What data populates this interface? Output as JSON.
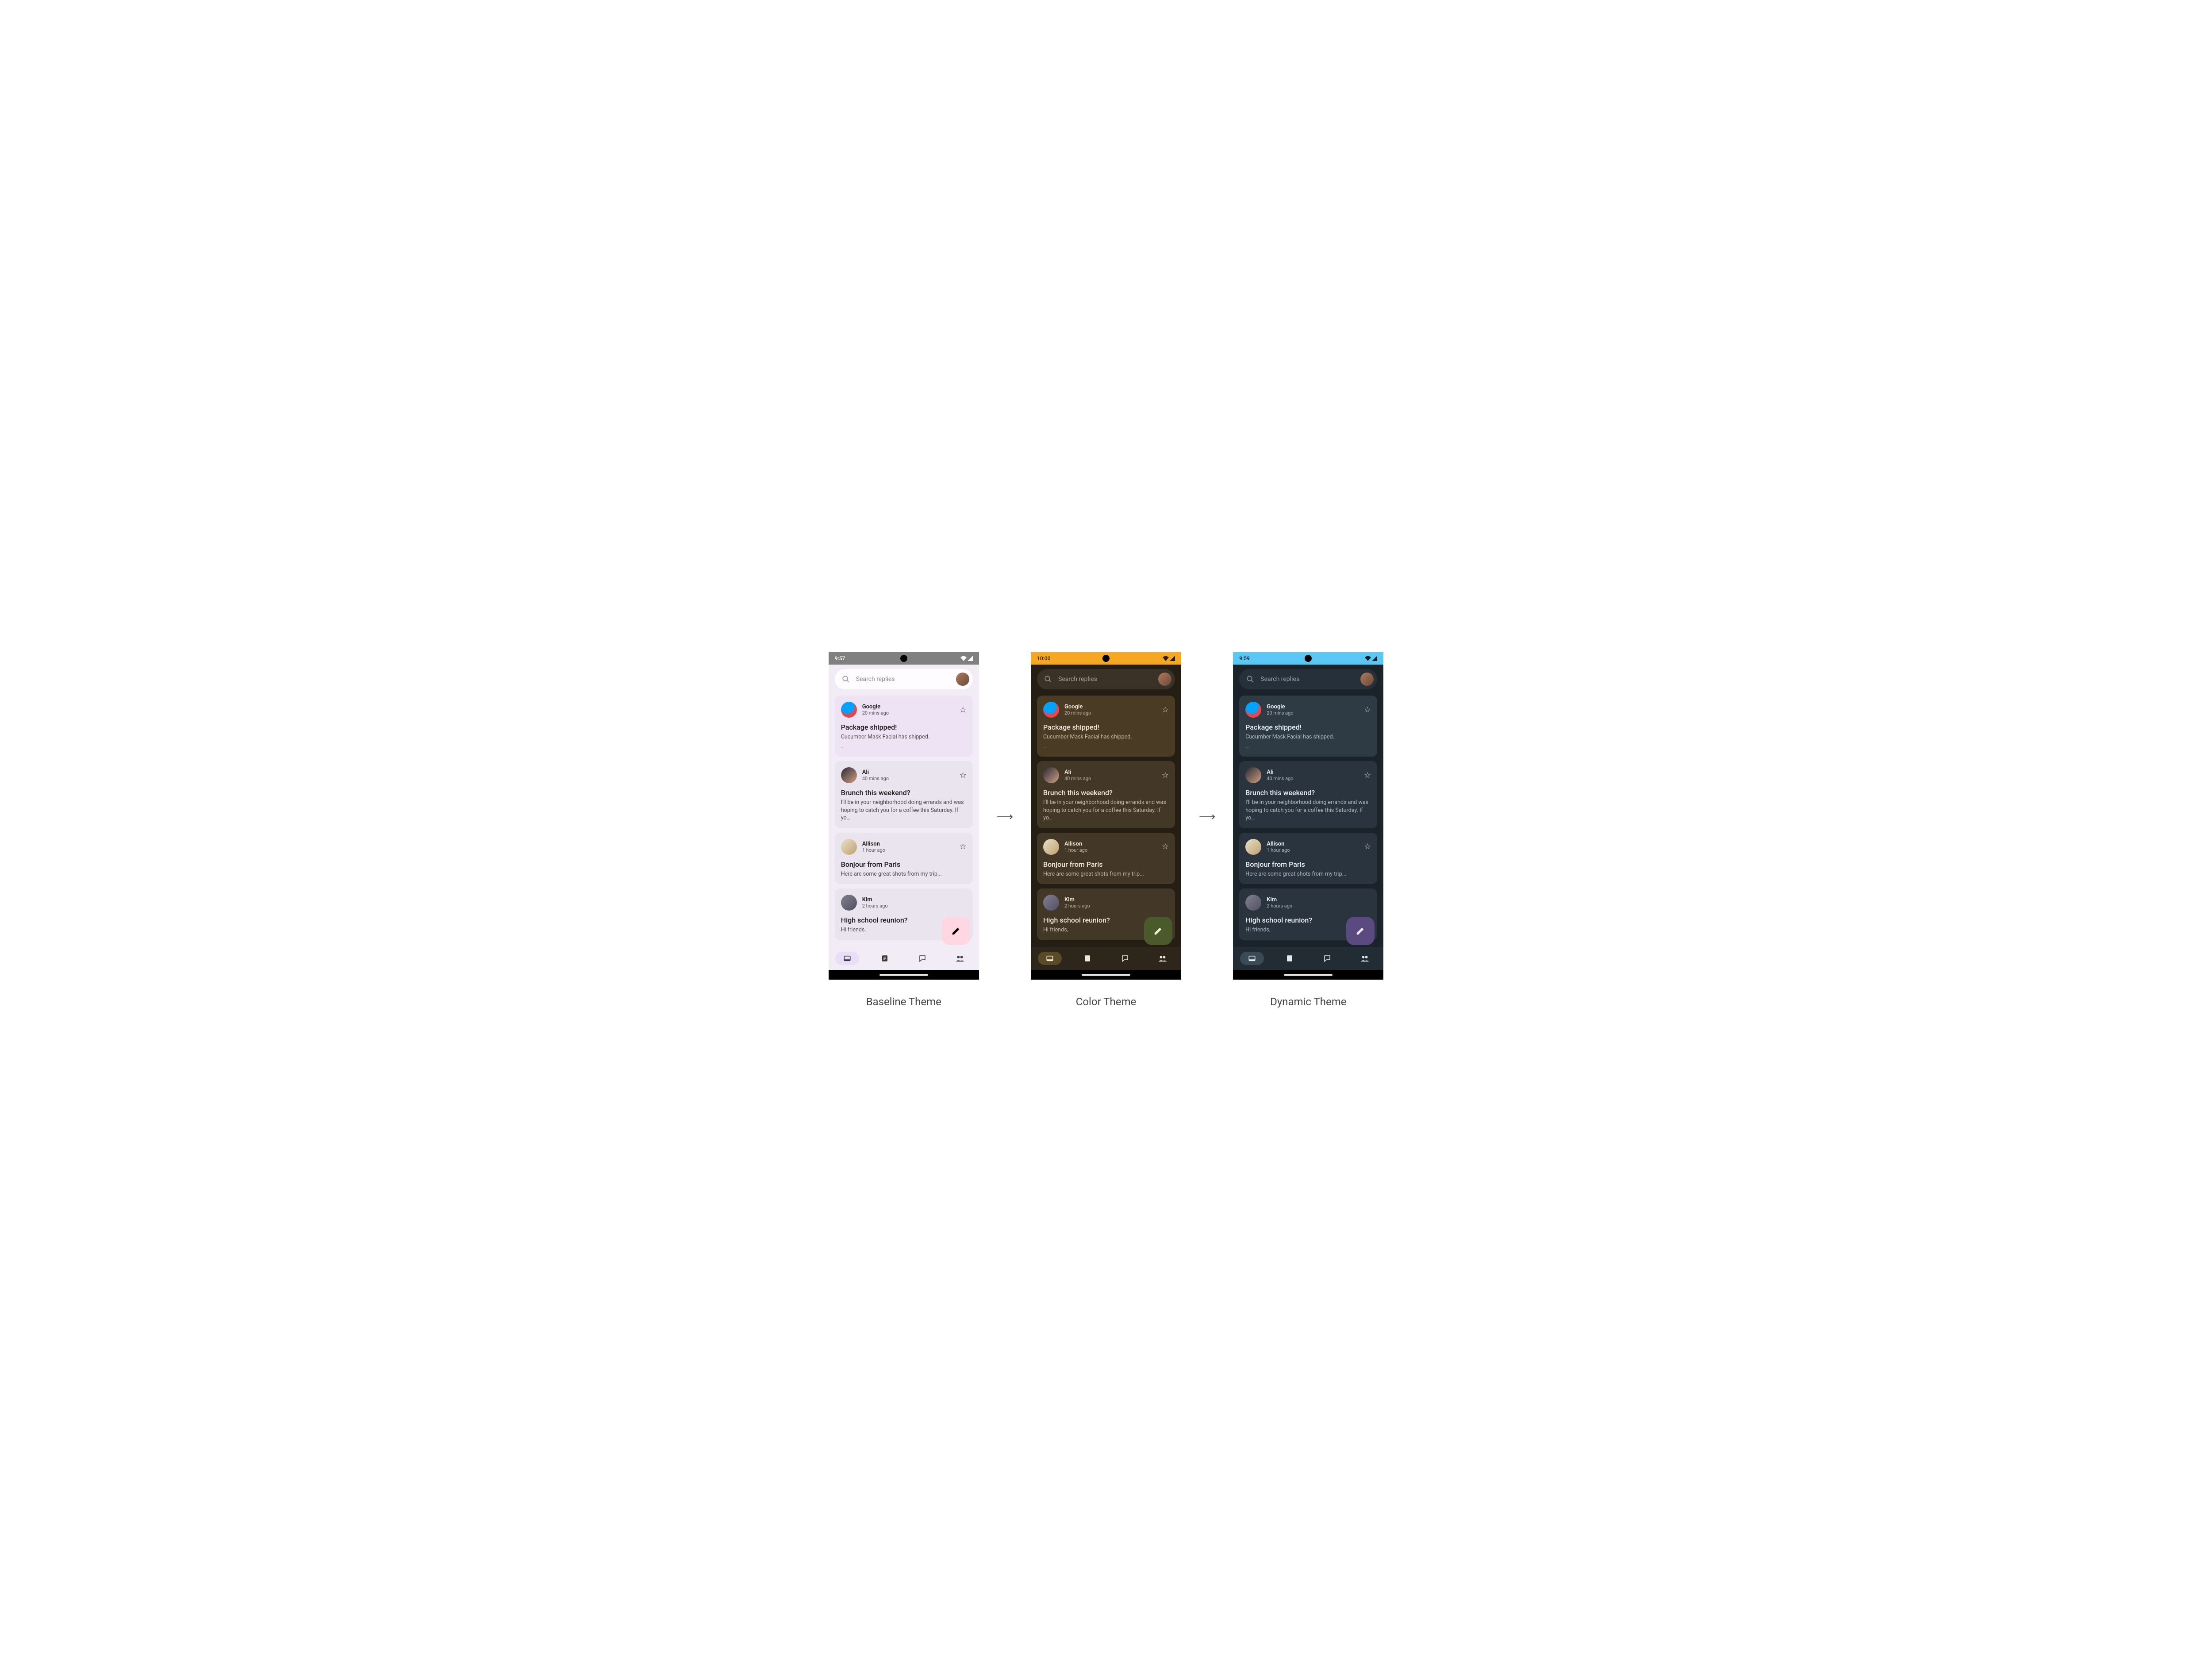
{
  "captions": {
    "baseline": "Baseline Theme",
    "color": "Color Theme",
    "dynamic": "Dynamic Theme"
  },
  "search_placeholder": "Search replies",
  "status_times": {
    "baseline": "9:57",
    "color": "10:00",
    "dynamic": "9:59"
  },
  "messages": [
    {
      "sender": "Google",
      "time": "20 mins ago",
      "subject": "Package shipped!",
      "snippet": "Cucumber Mask Facial has shipped.",
      "snippet2": "…",
      "avatar": "av-google"
    },
    {
      "sender": "Ali",
      "time": "40 mins ago",
      "subject": "Brunch this weekend?",
      "snippet": "I'll be in your neighborhood doing errands and was hoping to catch you for a coffee this Saturday. If yo…",
      "avatar": "av-ali"
    },
    {
      "sender": "Allison",
      "time": "1 hour ago",
      "subject": "Bonjour from Paris",
      "snippet": "Here are some great shots from my trip...",
      "avatar": "av-allison"
    },
    {
      "sender": "Kim",
      "time": "2 hours ago",
      "subject": "High school reunion?",
      "snippet_baseline": "Hi friends.",
      "snippet_dark": "Hi friends,",
      "avatar": "av-kim"
    }
  ],
  "nav_icons": [
    "inbox-icon",
    "article-icon",
    "chat-icon",
    "people-icon"
  ],
  "themes": {
    "baseline": {
      "status_bg": "#808080",
      "status_fg": "#ffffff",
      "body_bg": "#f1ecf6",
      "search_bg": "#fefcfe",
      "search_fg": "#555",
      "card_bg_primary": "#eee3f4",
      "card_bg_secondary": "#eae4ee",
      "card_fg": "#1a1a1a",
      "card_fg_sub": "#333",
      "nav_bg": "#f1ecf6",
      "nav_active_bg": "#e8def8",
      "nav_fg": "#3a3a3a",
      "fab_bg": "#ffd7e3",
      "fab_fg": "#000"
    },
    "color": {
      "status_bg": "#f6a823",
      "status_fg": "#2a1f10",
      "body_bg": "#251e14",
      "search_bg": "#3a3226",
      "search_fg": "#d8cfc0",
      "card_bg_primary": "#4a3c24",
      "card_bg_secondary": "#433828",
      "card_fg": "#f0e8d8",
      "card_fg_sub": "#d8cfc0",
      "nav_bg": "#2e261a",
      "nav_active_bg": "#5a4a28",
      "nav_fg": "#f0e8d8",
      "fab_bg": "#4a5a2a",
      "fab_fg": "#e8f0d0"
    },
    "dynamic": {
      "status_bg": "#5ac8f5",
      "status_fg": "#12202a",
      "body_bg": "#1a222a",
      "search_bg": "#26303a",
      "search_fg": "#c8d0d8",
      "card_bg_primary": "#2e3a44",
      "card_bg_secondary": "#2a343e",
      "card_fg": "#e8eef4",
      "card_fg_sub": "#c8d0d8",
      "nav_bg": "#222c34",
      "nav_active_bg": "#3a4a56",
      "nav_fg": "#e0e8f0",
      "fab_bg": "#5a4a80",
      "fab_fg": "#f0e8ff"
    }
  }
}
